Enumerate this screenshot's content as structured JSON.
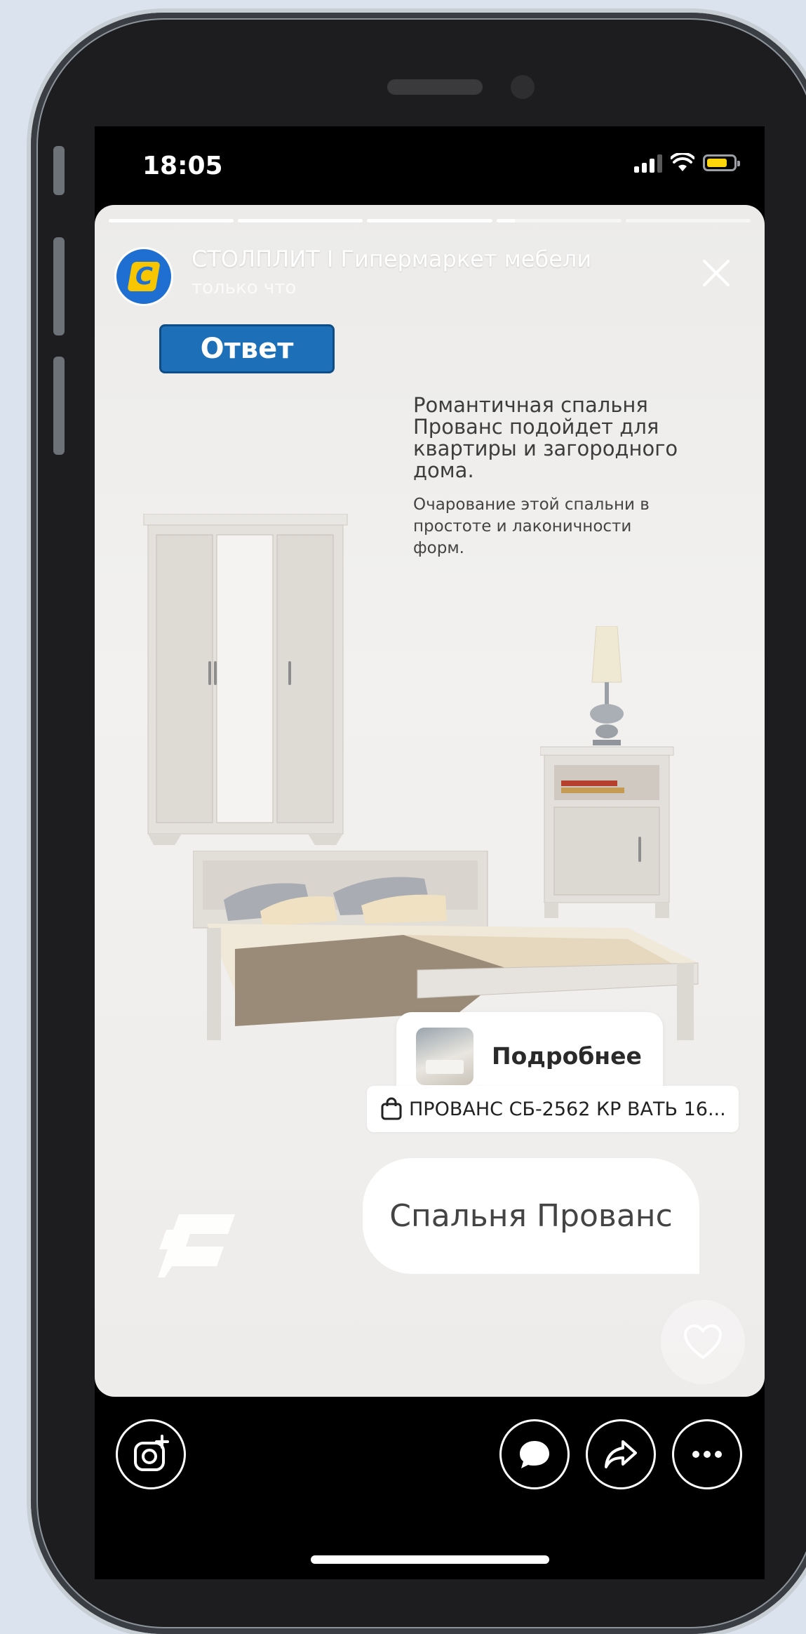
{
  "status_bar": {
    "time": "18:05"
  },
  "story": {
    "progress_segments": [
      1,
      1,
      1,
      0.15,
      0
    ],
    "account_name": "СТОЛПЛИТ I Гипермаркет мебели",
    "posted_time": "только что",
    "answer_button": "Ответ",
    "headline": "Романтичная спальня Прованс подойдет для квартиры и загородного дома.",
    "subtext": "Очарование этой спальни в простоте и лаконичности форм.",
    "product_card_label": "Подробнее",
    "product_tag": "ПРОВАНС СБ-2562 КР ВАТЬ 16...",
    "caption": "Спальня Прованс"
  },
  "icons": {
    "close": "close-icon",
    "like": "heart-icon",
    "camera": "camera-add-icon",
    "message": "chat-bubble-icon",
    "share": "share-icon",
    "more": "more-icon",
    "shopping": "shopping-bag-icon"
  },
  "colors": {
    "accent_blue": "#1d6fb8",
    "battery": "#ffd60a",
    "logo_yellow": "#f7c600"
  }
}
